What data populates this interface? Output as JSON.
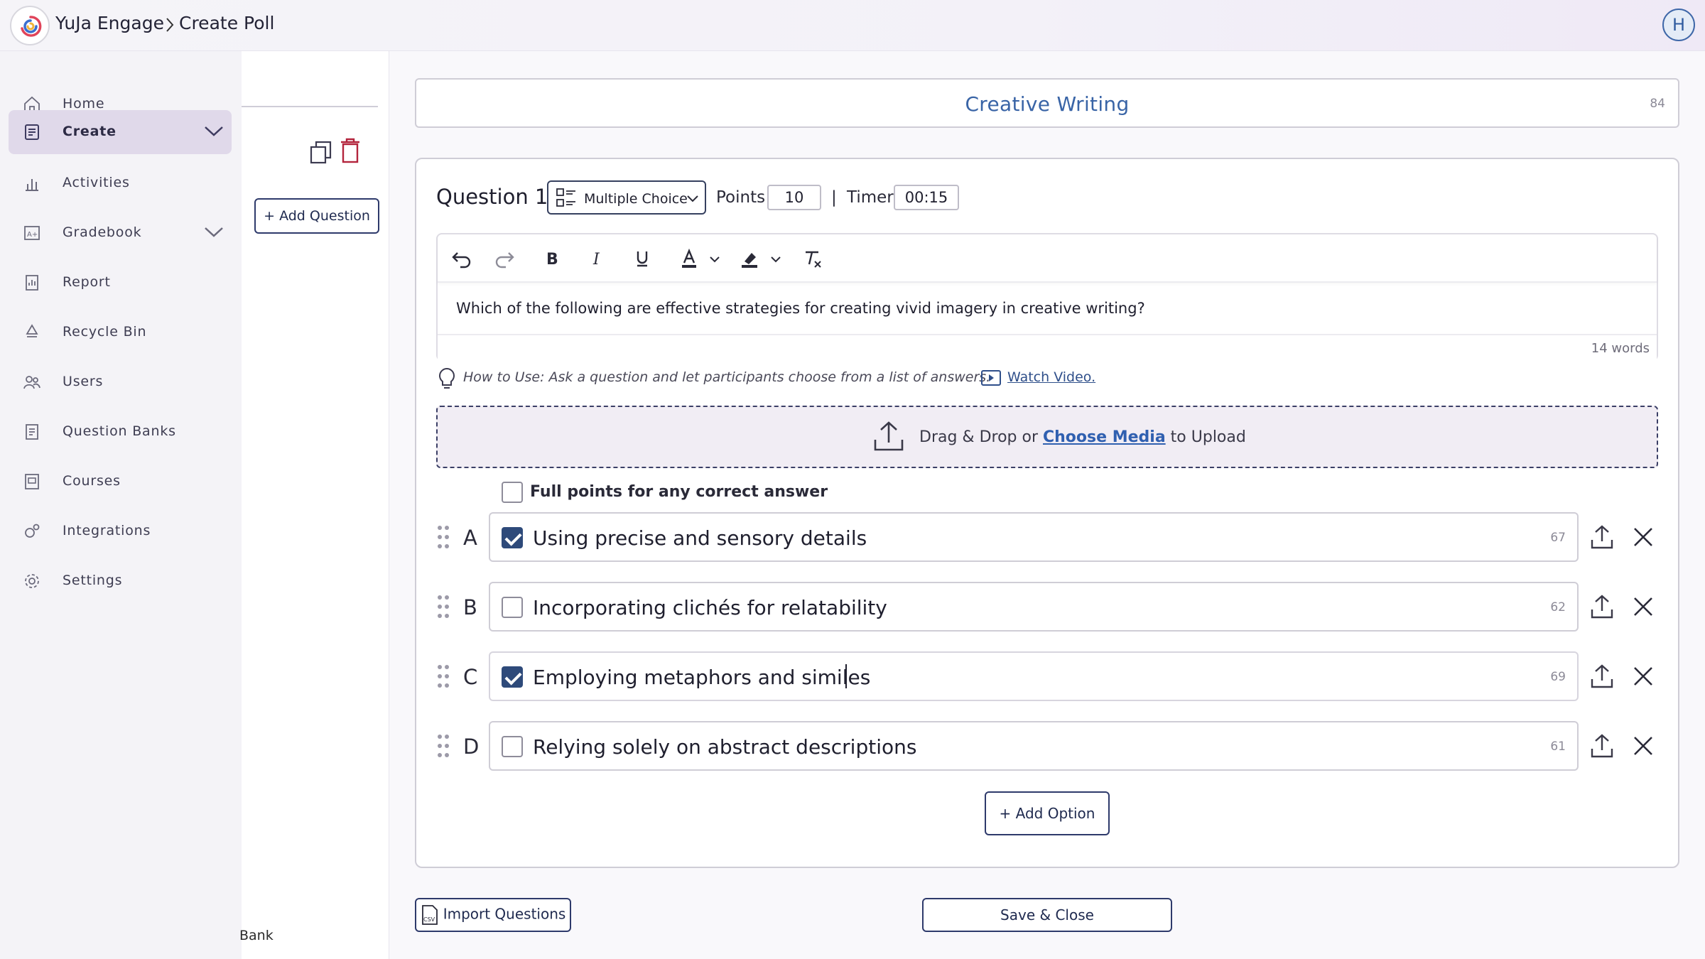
{
  "topbar": {
    "app_name": "YuJa Engage",
    "page_name": "Create Poll",
    "user_initial": "H"
  },
  "sidebar": {
    "items": [
      {
        "label": "Home",
        "icon": "home-icon"
      },
      {
        "label": "Create",
        "icon": "create-icon",
        "active": true,
        "expandable": true
      },
      {
        "label": "Activities",
        "icon": "bar-chart-icon"
      },
      {
        "label": "Gradebook",
        "icon": "gradebook-icon",
        "expandable": true
      },
      {
        "label": "Report",
        "icon": "report-icon"
      },
      {
        "label": "Recycle Bin",
        "icon": "recycle-icon"
      },
      {
        "label": "Users",
        "icon": "users-icon"
      },
      {
        "label": "Question Banks",
        "icon": "question-bank-icon"
      },
      {
        "label": "Courses",
        "icon": "courses-icon"
      },
      {
        "label": "Integrations",
        "icon": "integrations-icon"
      },
      {
        "label": "Settings",
        "icon": "gear-icon"
      }
    ]
  },
  "midpanel": {
    "add_question_label": "Add Question",
    "bank_label": "Bank"
  },
  "poll": {
    "title": "Creative Writing",
    "title_char_count": "84"
  },
  "question": {
    "label": "Question 1",
    "type": "Multiple Choice",
    "points_label": "Points",
    "points_value": "10",
    "separator": "|",
    "timer_label": "Timer",
    "timer_value": "00:15",
    "text": "Which of the following are effective strategies for creating vivid imagery in creative writing?",
    "word_count": "14 words",
    "how_to": "How to Use: Ask a question and let participants choose from a list of answers.",
    "watch_video": "Watch Video."
  },
  "upload": {
    "prefix": "Drag & Drop or",
    "link": "Choose Media",
    "suffix": "to Upload"
  },
  "full_points_label": "Full points for any correct answer",
  "options": [
    {
      "letter": "A",
      "text": "Using precise and sensory details",
      "count": "67",
      "correct": true
    },
    {
      "letter": "B",
      "text": "Incorporating clichés for relatability",
      "count": "62",
      "correct": false
    },
    {
      "letter": "C",
      "text": "Employing metaphors and similes",
      "count": "69",
      "correct": true
    },
    {
      "letter": "D",
      "text": "Relying solely on abstract descriptions",
      "count": "61",
      "correct": false
    }
  ],
  "buttons": {
    "add_option": "Add Option",
    "import_questions": "Import Questions",
    "save_close": "Save & Close"
  },
  "colors": {
    "accent": "#2e3a6b",
    "title_blue": "#3964a6",
    "delete_red": "#b3243c",
    "active_nav_bg": "#e0d9ea"
  }
}
